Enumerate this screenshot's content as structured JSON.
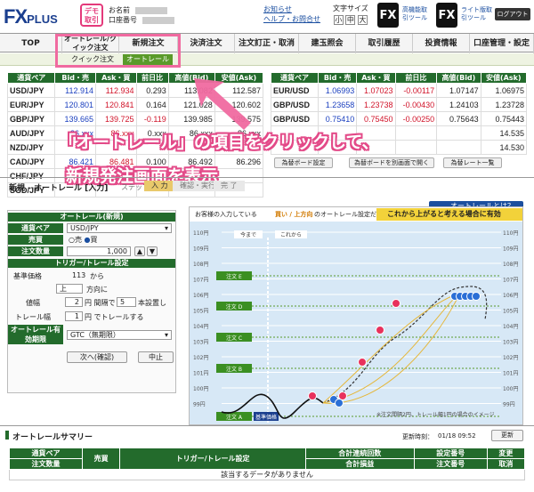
{
  "header": {
    "logo_main": "FX",
    "logo_sub": "PLUS",
    "demo_badge": "デモ取引",
    "account_name_label": "お名前",
    "account_number_label": "口座番号",
    "links": [
      "お知らせ",
      "ヘルプ・お問合せ"
    ],
    "font_size_label": "文字サイズ",
    "font_sizes": [
      "小",
      "中",
      "大"
    ],
    "tools": [
      {
        "icon_text": "FX",
        "label": "高機能取引ツール"
      },
      {
        "icon_text": "FX",
        "label": "ライト版取引ツール"
      }
    ],
    "logout": "ログアウト"
  },
  "nav": {
    "items": [
      "TOP",
      "オートレール/クイック注文",
      "新規注文",
      "決済注文",
      "注文訂正・取消",
      "建玉照会",
      "取引履歴",
      "投資情報",
      "口座管理・設定"
    ],
    "sub_items": [
      "クイック注文",
      "オートレール"
    ]
  },
  "rates_left": {
    "headers": [
      "通貨ペア",
      "Bid・売",
      "Ask・買",
      "前日比",
      "高値(Bid)",
      "安値(Ask)"
    ],
    "rows": [
      [
        "USD/JPY",
        "112.914",
        "112.934",
        "0.293",
        "113.082",
        "112.587"
      ],
      [
        "EUR/JPY",
        "120.801",
        "120.841",
        "0.164",
        "121.028",
        "120.602"
      ],
      [
        "GBP/JPY",
        "139.665",
        "139.725",
        "-0.119",
        "139.985",
        "139.575"
      ],
      [
        "AUD/JPY",
        "86.xxx",
        "86.xxx",
        "0.xxx",
        "86.xxx",
        "86.xxx"
      ],
      [
        "NZD/JPY",
        "",
        "",
        "",
        "",
        ""
      ],
      [
        "CAD/JPY",
        "86.421",
        "86.481",
        "0.100",
        "86.492",
        "86.296"
      ],
      [
        "CHF/JPY",
        "",
        "",
        "",
        "",
        ""
      ],
      [
        "SGD/JPY",
        "",
        "",
        "",
        "",
        ""
      ]
    ]
  },
  "rates_right": {
    "headers": [
      "通貨ペア",
      "Bid・売",
      "Ask・買",
      "前日比",
      "高値(Bid)",
      "安値(Ask)"
    ],
    "rows": [
      [
        "EUR/USD",
        "1.06993",
        "1.07023",
        "-0.00117",
        "1.07147",
        "1.06975"
      ],
      [
        "GBP/USD",
        "1.23658",
        "1.23738",
        "-0.00430",
        "1.24103",
        "1.23728"
      ],
      [
        "GBP/USD",
        "0.75410",
        "0.75450",
        "-0.00250",
        "0.75643",
        "0.75443"
      ],
      [
        "",
        "",
        "",
        "",
        "",
        "14.535"
      ],
      [
        "",
        "",
        "",
        "",
        "",
        "14.530"
      ]
    ]
  },
  "rate_buttons": [
    "為替ボード設定",
    "為替ボードを別画面で開く",
    "為替レート一覧"
  ],
  "overlay": {
    "line1": "「オートレール」の項目をクリックして、",
    "line2": "新規発注画面を表示"
  },
  "order_section": {
    "title": "新規 - オートレール [入力]",
    "step_label": "ステップ",
    "steps": [
      "入 力",
      "確認・実行",
      "完 了"
    ],
    "promo": "オートレールとは？丸わかり動画！"
  },
  "form": {
    "header": "オートレール(新規)",
    "pair_label": "通貨ペア",
    "pair_value": "USD/JPY",
    "side_label": "売買",
    "side_options": [
      "売",
      "買"
    ],
    "qty_label": "注文数量",
    "qty_value": "1,000",
    "trigger_header": "トリガー/トレール設定",
    "base_label": "基準価格",
    "base_value": "113",
    "base_suffix": "から",
    "dir_value": "上",
    "dir_suffix": "方向に",
    "width_label": "値幅",
    "width_value": "2",
    "interval_label": "円 間隔で",
    "count_value": "5",
    "count_label": "本設置し",
    "trail_label": "トレール幅",
    "trail_value": "1",
    "trail_suffix": "円 でトレールする",
    "expiry_label": "オートレール有効期限",
    "expiry_value": "GTC（無期限）",
    "next_button": "次へ(確認)",
    "cancel_button": "中止"
  },
  "diagram": {
    "banner_left": "お客様の入力している",
    "banner_highlight": "買い / 上方向",
    "banner_mid": "のオートレール設定だと",
    "banner_right": "これから上がると考える場合に有効",
    "now_label": "今まで",
    "future_label": "これから",
    "price_labels": [
      "110円",
      "109円",
      "108円",
      "107円",
      "106円",
      "105円",
      "104円",
      "103円",
      "102円",
      "101円",
      "100円",
      "99円"
    ],
    "order_labels": [
      "注文 E",
      "注文 D",
      "注文 C",
      "注文 B",
      "注文 A"
    ],
    "base_label": "基準価格",
    "note": "※注文間隔2円、トレール幅1円の場合のイメージ"
  },
  "summary": {
    "title": "オートレールサマリー",
    "updated_label": "更新時刻：",
    "updated_value": "01/18 09:52",
    "refresh": "更新",
    "headers_row1": [
      "通貨ペア",
      "売買",
      "トリガー/トレール設定",
      "合計連続回数",
      "設定番号",
      "変更"
    ],
    "headers_row2": [
      "注文数量",
      "",
      "",
      "合計損益",
      "注文番号",
      "取消"
    ],
    "empty_message": "該当するデータがありません"
  },
  "colors": {
    "brand_green": "#236b2c",
    "accent_pink": "#e34a88",
    "bid_blue": "#1a3fbf",
    "ask_red": "#d1142a"
  }
}
